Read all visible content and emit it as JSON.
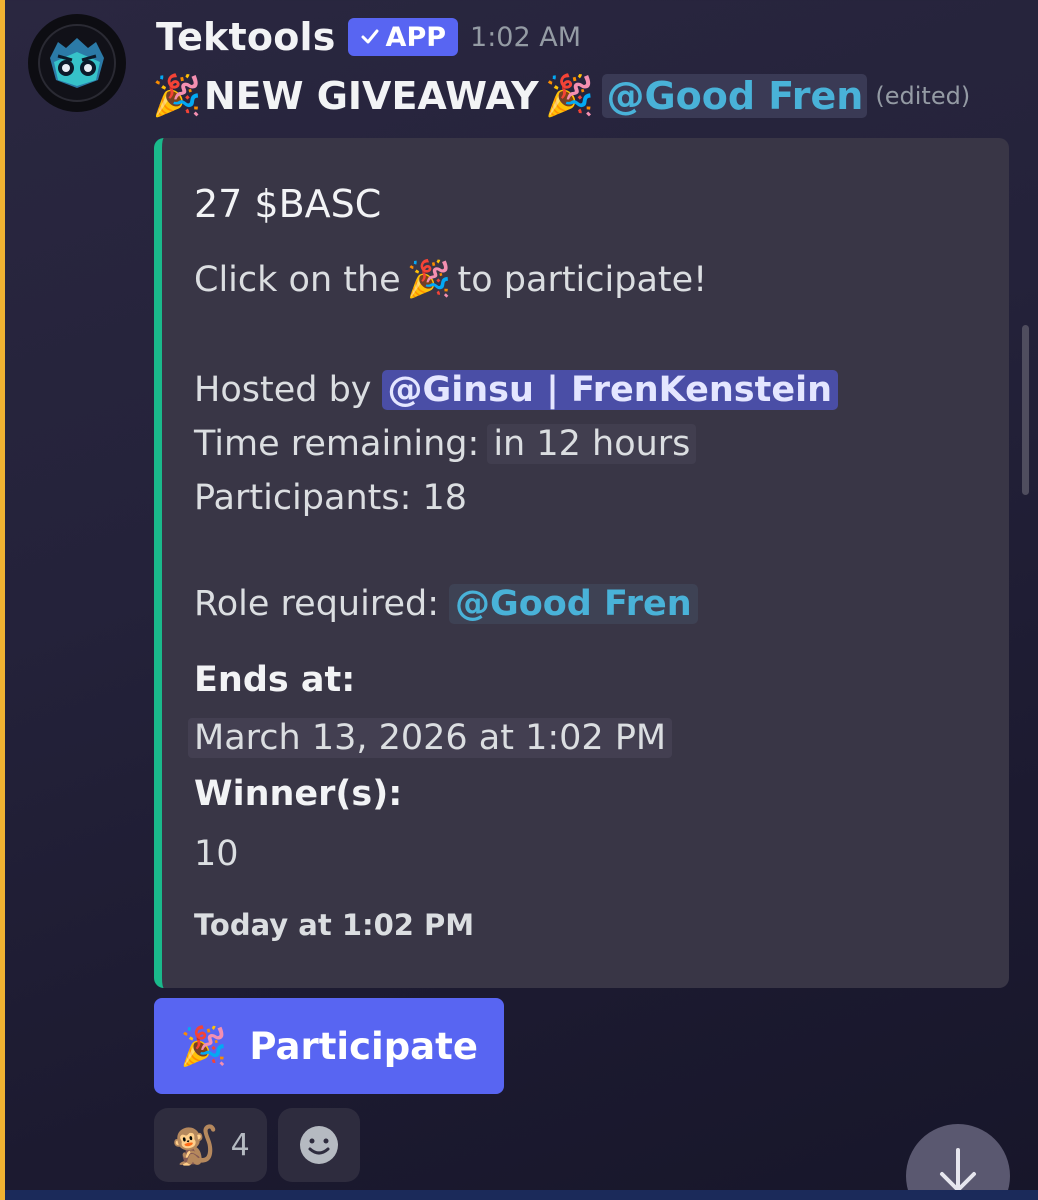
{
  "message": {
    "author": "Tektools",
    "badge": "APP",
    "timestamp": "1:02 AM",
    "content_text": "NEW GIVEAWAY",
    "mention": "@Good Fren",
    "edited": "(edited)",
    "party_emoji": "🎉"
  },
  "embed": {
    "title": "27 $BASC",
    "click_prefix": "Click on the",
    "click_suffix": "to participate!",
    "hosted_label": "Hosted by",
    "host": "@Ginsu | FrenKenstein",
    "time_label": "Time remaining:",
    "time_value": "in 12 hours",
    "participants": "Participants: 18",
    "role_label": "Role required:",
    "role": "@Good Fren",
    "ends_label": "Ends at:",
    "ends_value": "March 13, 2026 at 1:02 PM",
    "winners_label": "Winner(s):",
    "winners_value": "10",
    "footer": "Today at 1:02 PM",
    "accent_color": "#1ab98b"
  },
  "button": {
    "label": "Participate",
    "emoji": "🎉",
    "color": "#5865f2"
  },
  "reactions": [
    {
      "emoji": "🐒",
      "count": "4"
    }
  ],
  "icons": {
    "add_reaction": "smiley-add-reaction-icon",
    "scroll": "arrow-down-icon",
    "verified": "checkmark-icon"
  }
}
